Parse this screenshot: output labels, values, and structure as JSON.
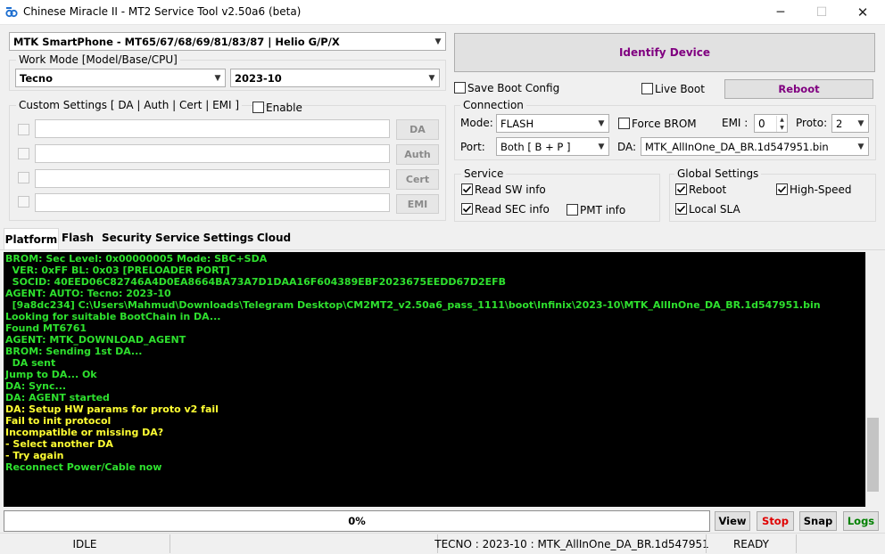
{
  "window": {
    "title": "Chinese Miracle II - MT2 Service Tool v2.50a6 (beta)",
    "minimize": "─",
    "maximize": "☐",
    "close": "✕"
  },
  "platform_combo": "MTK SmartPhone - MT65/67/68/69/81/83/87 | Helio G/P/X",
  "work_mode": {
    "title": "Work Mode [Model/Base/CPU]",
    "brand": "Tecno",
    "base": "2023-10"
  },
  "custom_settings": {
    "title": "Custom Settings [ DA | Auth | Cert | EMI ]",
    "enable_label": "Enable",
    "buttons": [
      "DA",
      "Auth",
      "Cert",
      "EMI"
    ]
  },
  "identify_label": "Identify Device",
  "save_boot_label": "Save Boot Config",
  "live_boot_label": "Live Boot",
  "reboot_label": "Reboot",
  "connection": {
    "title": "Connection",
    "mode_label": "Mode:",
    "mode_value": "FLASH",
    "force_brom_label": "Force BROM",
    "emi_label": "EMI :",
    "emi_value": "0",
    "proto_label": "Proto:",
    "proto_value": "2",
    "port_label": "Port:",
    "port_value": "Both [ B + P ]",
    "da_label": "DA:",
    "da_value": "MTK_AllInOne_DA_BR.1d547951.bin"
  },
  "service": {
    "title": "Service",
    "read_sw": "Read SW info",
    "read_sec": "Read SEC info",
    "pmt": "PMT info"
  },
  "global_settings": {
    "title": "Global Settings",
    "reboot": "Reboot",
    "high_speed": "High-Speed",
    "local_sla": "Local SLA"
  },
  "tabs": [
    "Platform",
    "Flash",
    "Security",
    "Service",
    "Settings",
    "Cloud"
  ],
  "log": [
    {
      "text": "BROM: Sec Level: 0x00000005 Mode: SBC+SDA",
      "color": "green"
    },
    {
      "text": "  VER: 0xFF BL: 0x03 [PRELOADER PORT]",
      "color": "green"
    },
    {
      "text": "  SOCID: 40EED06C82746A4D0EA8664BA73A7D1DAA16F604389EBF2023675EEDD67D2EFB",
      "color": "green"
    },
    {
      "text": "AGENT: AUTO: Tecno: 2023-10",
      "color": "green"
    },
    {
      "text": "  [9a8dc234] C:\\Users\\Mahmud\\Downloads\\Telegram Desktop\\CM2MT2_v2.50a6_pass_1111\\boot\\Infinix\\2023-10\\MTK_AllInOne_DA_BR.1d547951.bin",
      "color": "green"
    },
    {
      "text": "Looking for suitable BootChain in DA...",
      "color": "green"
    },
    {
      "text": "Found MT6761",
      "color": "green"
    },
    {
      "text": "AGENT: MTK_DOWNLOAD_AGENT",
      "color": "green"
    },
    {
      "text": "BROM: Sending 1st DA...",
      "color": "green"
    },
    {
      "text": "  DA sent",
      "color": "green"
    },
    {
      "text": "Jump to DA... Ok",
      "color": "green"
    },
    {
      "text": "DA: Sync...",
      "color": "green"
    },
    {
      "text": "DA: AGENT started",
      "color": "green"
    },
    {
      "text": "DA: Setup HW params for proto v2 fail",
      "color": "yellow"
    },
    {
      "text": "Fail to init protocol",
      "color": "yellow"
    },
    {
      "text": "Incompatible or missing DA?",
      "color": "yellow"
    },
    {
      "text": "- Select another DA",
      "color": "yellow"
    },
    {
      "text": "- Try again",
      "color": "yellow"
    },
    {
      "text": "Reconnect Power/Cable now",
      "color": "green"
    }
  ],
  "progress_label": "0%",
  "actions": {
    "view": "View",
    "stop": "Stop",
    "snap": "Snap",
    "logs": "Logs"
  },
  "colors": {
    "identify": "#800080",
    "reboot": "#800080",
    "stop": "#e00000",
    "logs": "#008000"
  },
  "status": {
    "state": "IDLE",
    "info": "TECNO : 2023-10 : MTK_AllInOne_DA_BR.1d547951",
    "ready": "READY"
  }
}
